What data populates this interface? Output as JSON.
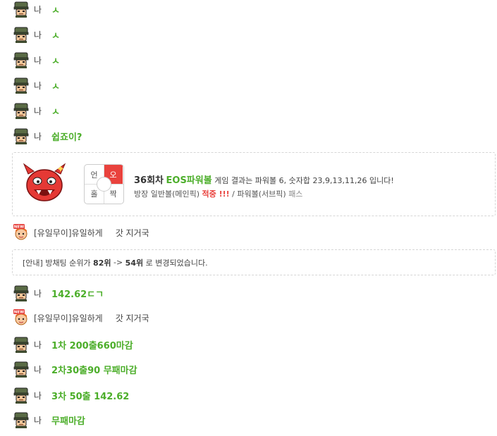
{
  "top_fragment": "· · · · ·",
  "colors": {
    "green": "#4cae2a",
    "red": "#e9423d"
  },
  "messages_top": [
    {
      "nick": "나",
      "text": "ㅅ"
    },
    {
      "nick": "나",
      "text": "ㅅ"
    },
    {
      "nick": "나",
      "text": "ㅅ"
    },
    {
      "nick": "나",
      "text": "ㅅ"
    },
    {
      "nick": "나",
      "text": "ㅅ"
    },
    {
      "nick": "나",
      "text": "쉽죠이?"
    }
  ],
  "result_card": {
    "oddeven": {
      "q1": "언",
      "q2": "오",
      "q3": "홀",
      "q4": "짝"
    },
    "round": "36회차",
    "game": "EOS파워볼",
    "result_text": "게임 결과는 파워볼 6, 숫자합 23,9,13,11,26 입니다!",
    "line2_a": "방장 일반볼(메인픽)",
    "line2_hit": "적중 !!!",
    "line2_b": "/ 파워볼(서브픽)",
    "line2_pass": "패스"
  },
  "user_msg_1": {
    "badge": "NEW",
    "nick": "[유일무이]유일하게",
    "text": "갓 지거국"
  },
  "notice": {
    "prefix": "[안내] 방채팅 순위가",
    "from": "82위",
    "arrow": "->",
    "to": "54위",
    "suffix": "로 변경되었습니다."
  },
  "msg_mid": {
    "nick": "나",
    "text": "142.62ㄷㄱ"
  },
  "user_msg_2": {
    "badge": "NEW",
    "nick": "[유일무이]유일하게",
    "text": "갓 지거국"
  },
  "messages_bottom": [
    {
      "nick": "나",
      "text": "1차 200출660마감"
    },
    {
      "nick": "나",
      "text": "2차30출90 무패마감"
    },
    {
      "nick": "나",
      "text": "3차 50출 142.62"
    },
    {
      "nick": "나",
      "text": "무패마감"
    }
  ]
}
